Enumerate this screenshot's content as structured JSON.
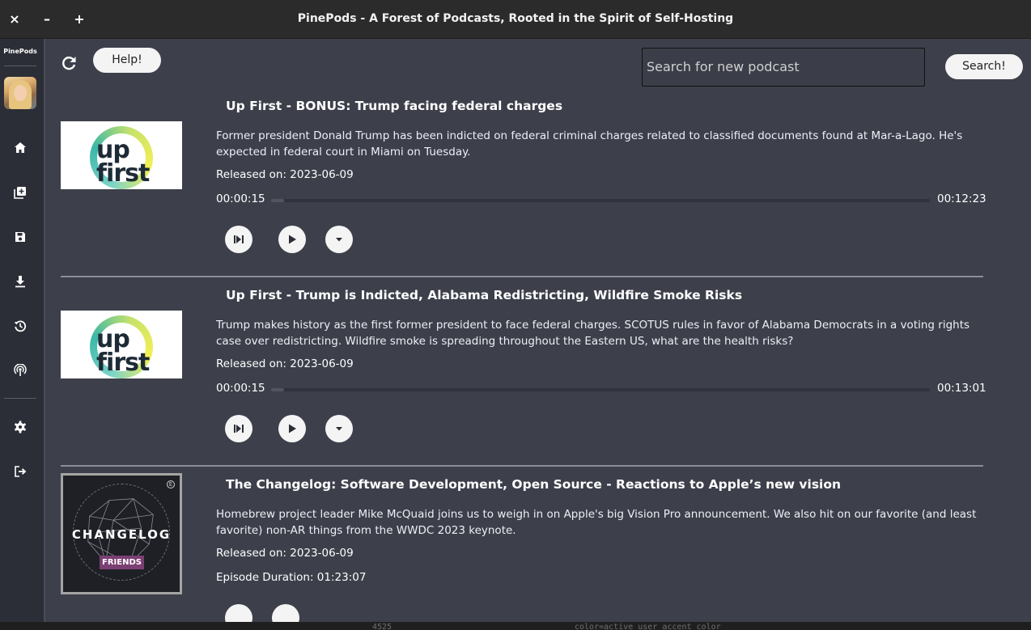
{
  "window": {
    "title": "PinePods - A Forest of Podcasts, Rooted in the Spirit of Self-Hosting",
    "close_label": "×",
    "minimize_label": "–",
    "maximize_label": "+"
  },
  "sidebar": {
    "brand": "PinePods",
    "nav": [
      "home-icon",
      "queue-icon",
      "saved-icon",
      "download-icon",
      "history-icon",
      "podcasts-icon",
      "settings-icon",
      "logout-icon"
    ]
  },
  "toolbar": {
    "help_label": "Help!",
    "search_placeholder": "Search for new podcast",
    "search_label": "Search!"
  },
  "episodes": [
    {
      "title": "Up First - BONUS: Trump facing federal charges",
      "description": "Former president Donald Trump has been indicted on federal criminal charges related to classified documents found at Mar-a-Lago. He's expected in federal court in Miami on Tuesday.",
      "released": "Released on: 2023-06-09",
      "elapsed": "00:00:15",
      "total": "00:12:23",
      "progress_fraction": 0.02,
      "art_word_1": "up",
      "art_word_2": "first"
    },
    {
      "title": "Up First - Trump is Indicted, Alabama Redistricting, Wildfire Smoke Risks",
      "description": "Trump makes history as the first former president to face federal charges. SCOTUS rules in favor of Alabama Democrats in a voting rights case over redistricting. Wildfire smoke is spreading throughout the Eastern US, what are the health risks?",
      "released": "Released on: 2023-06-09",
      "elapsed": "00:00:15",
      "total": "00:13:01",
      "progress_fraction": 0.02,
      "art_word_1": "up",
      "art_word_2": "first"
    },
    {
      "title": "The Changelog: Software Development, Open Source - Reactions to Apple’s new vision",
      "description": "Homebrew project leader Mike McQuaid joins us to weigh in on Apple's big Vision Pro announcement. We also hit on our favorite (and least favorite) non-AR things from the WWDC 2023 keynote.",
      "released": "Released on: 2023-06-09",
      "duration": "Episode Duration: 01:23:07",
      "art_word": "CHANGELOG",
      "art_badge": "FRIENDS",
      "art_e": "E"
    }
  ],
  "background_code": {
    "line_number": "4525",
    "line_text": "color=active_user_accent_color"
  },
  "colors": {
    "background": "#3d404b",
    "sidebar": "#2b2e36",
    "titlebar": "#2b2b2b",
    "button": "#f4f4f4"
  }
}
